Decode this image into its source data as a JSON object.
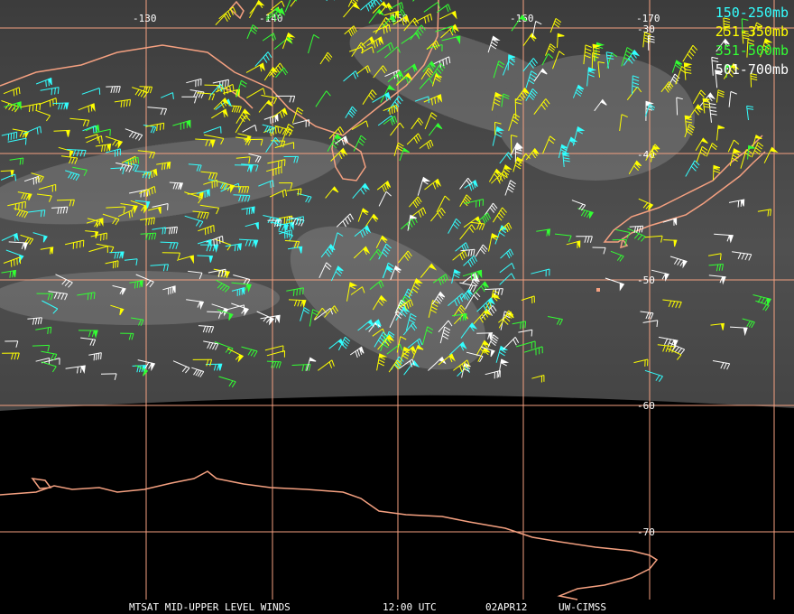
{
  "legend": [
    {
      "label": "150-250mb",
      "color": "#33ffff"
    },
    {
      "label": "251-350mb",
      "color": "#ffff00"
    },
    {
      "label": "351-500mb",
      "color": "#33ff33"
    },
    {
      "label": "501-700mb",
      "color": "#ffffff"
    }
  ],
  "longitude_labels": [
    "-130",
    "-140",
    "-150",
    "-160",
    "-170"
  ],
  "latitude_labels": [
    "-30",
    "-40",
    "-50",
    "-60",
    "-70"
  ],
  "footer": {
    "product": "MTSAT MID-UPPER LEVEL WINDS",
    "time": "12:00 UTC",
    "date": "02APR12",
    "source": "UW-CIMSS"
  },
  "colors": {
    "grid": "#f4a080",
    "coast": "#f4a080",
    "imagery": "#4a4a4a",
    "background": "#000000"
  }
}
